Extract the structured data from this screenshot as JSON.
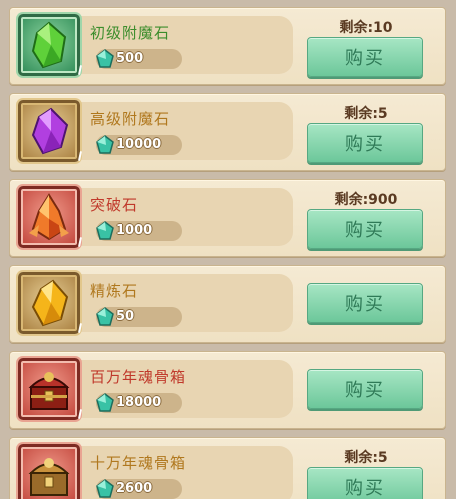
{
  "items": [
    {
      "name": "初级附魔石",
      "price": "500",
      "remaining": "剩余:10",
      "buy_label": "购买",
      "name_color": "#3c8d2c",
      "icon": "green-crystal-icon"
    },
    {
      "name": "高级附魔石",
      "price": "10000",
      "remaining": "剩余:5",
      "buy_label": "购买",
      "name_color": "#b0781e",
      "icon": "purple-crystal-icon"
    },
    {
      "name": "突破石",
      "price": "1000",
      "remaining": "剩余:900",
      "buy_label": "购买",
      "name_color": "#c0392b",
      "icon": "fire-stone-icon"
    },
    {
      "name": "精炼石",
      "price": "50",
      "remaining": "",
      "buy_label": "购买",
      "name_color": "#b0781e",
      "icon": "yellow-crystal-icon"
    },
    {
      "name": "百万年魂骨箱",
      "price": "18000",
      "remaining": "",
      "buy_label": "购买",
      "name_color": "#c0392b",
      "icon": "red-chest-icon"
    },
    {
      "name": "十万年魂骨箱",
      "price": "2600",
      "remaining": "剩余:5",
      "buy_label": "购买",
      "name_color": "#b0781e",
      "icon": "gold-chest-icon"
    }
  ],
  "currency_icon": "jade-gem-icon"
}
